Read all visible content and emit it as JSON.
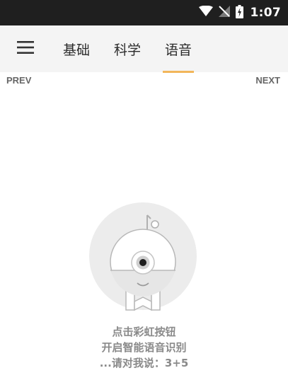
{
  "status_bar": {
    "time": "1:07",
    "icons": [
      "wifi-icon",
      "no-signal-icon",
      "battery-charging-icon"
    ]
  },
  "toolbar": {
    "menu_icon": "hamburger-menu-icon",
    "tabs": [
      {
        "label": "基础",
        "selected": false
      },
      {
        "label": "科学",
        "selected": false
      },
      {
        "label": "语音",
        "selected": true
      }
    ],
    "indicator_color": "#f2b65a"
  },
  "pager": {
    "prev_label": "PREV",
    "next_label": "NEXT"
  },
  "main": {
    "illustration_icon": "robot-mascot-icon",
    "prompt_lines": [
      "点击彩虹按钮",
      "开启智能语音识别",
      "...请对我说：3+5"
    ]
  }
}
